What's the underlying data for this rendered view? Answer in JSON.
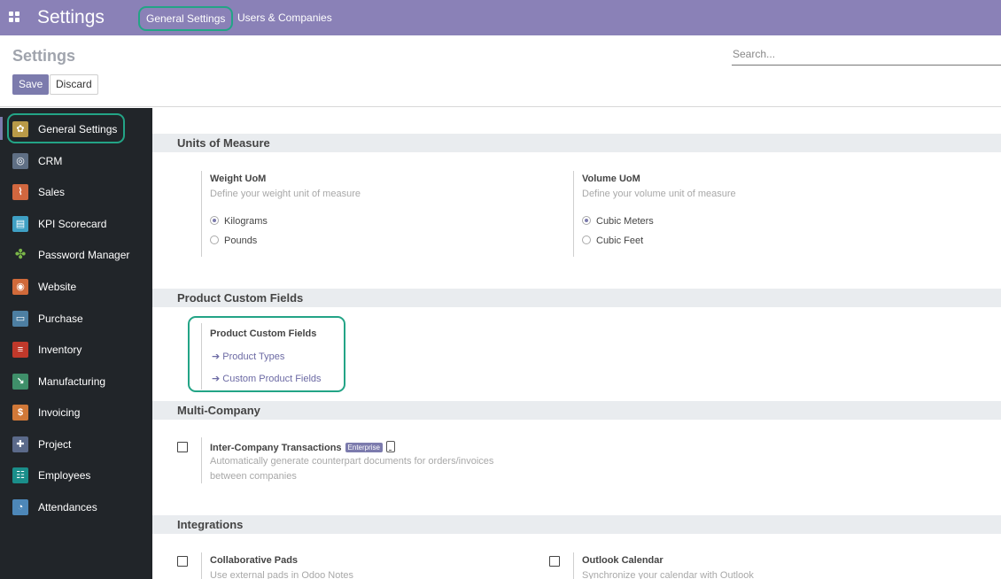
{
  "navbar": {
    "app_title": "Settings",
    "links": [
      "General Settings",
      "Users & Companies"
    ]
  },
  "control": {
    "title": "Settings",
    "save_label": "Save",
    "discard_label": "Discard",
    "search_placeholder": "Search..."
  },
  "sidebar": {
    "items": [
      {
        "label": "General Settings",
        "icon": "gear-icon",
        "color": "#b99a48"
      },
      {
        "label": "CRM",
        "icon": "handshake-icon",
        "color": "#5f6f84"
      },
      {
        "label": "Sales",
        "icon": "chart-icon",
        "color": "#d1673f"
      },
      {
        "label": "KPI Scorecard",
        "icon": "scorecard-icon",
        "color": "#3fa0c4"
      },
      {
        "label": "Password Manager",
        "icon": "pinwheel-icon",
        "color": "#6b9f3a"
      },
      {
        "label": "Website",
        "icon": "globe-icon",
        "color": "#d06a3a"
      },
      {
        "label": "Purchase",
        "icon": "card-icon",
        "color": "#4d7fa2"
      },
      {
        "label": "Inventory",
        "icon": "box-icon",
        "color": "#c0392b"
      },
      {
        "label": "Manufacturing",
        "icon": "wrench-icon",
        "color": "#3f8f6a"
      },
      {
        "label": "Invoicing",
        "icon": "invoice-icon",
        "color": "#d07838"
      },
      {
        "label": "Project",
        "icon": "puzzle-icon",
        "color": "#5b6a8a"
      },
      {
        "label": "Employees",
        "icon": "people-icon",
        "color": "#1a8e8a"
      },
      {
        "label": "Attendances",
        "icon": "user-clock-icon",
        "color": "#4d87b8"
      }
    ]
  },
  "sections": {
    "uom": {
      "title": "Units of Measure",
      "weight": {
        "title": "Weight UoM",
        "desc": "Define your weight unit of measure",
        "options": [
          "Kilograms",
          "Pounds"
        ],
        "selected": "Kilograms"
      },
      "volume": {
        "title": "Volume UoM",
        "desc": "Define your volume unit of measure",
        "options": [
          "Cubic Meters",
          "Cubic Feet"
        ],
        "selected": "Cubic Meters"
      }
    },
    "pcf": {
      "title": "Product Custom Fields",
      "setting_title": "Product Custom Fields",
      "links": [
        "Product Types",
        "Custom Product Fields"
      ]
    },
    "multi": {
      "title": "Multi-Company",
      "setting_title": "Inter-Company Transactions",
      "badge": "Enterprise",
      "desc_lines": [
        "Automatically generate counterpart documents for orders/invoices",
        "between companies"
      ]
    },
    "integrations": {
      "title": "Integrations",
      "pads": {
        "title": "Collaborative Pads",
        "desc": "Use external pads in Odoo Notes"
      },
      "outlook": {
        "title": "Outlook Calendar",
        "desc": "Synchronize your calendar with Outlook"
      }
    }
  }
}
